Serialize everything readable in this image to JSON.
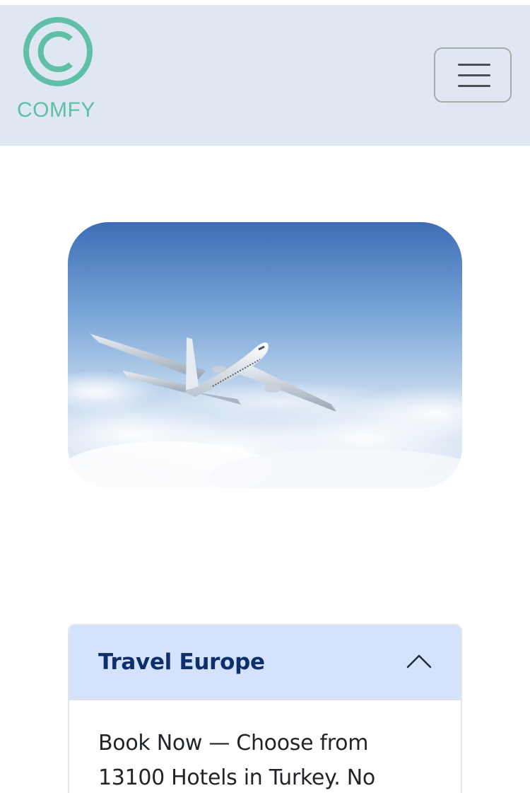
{
  "navbar": {
    "brand_name": "COMFY",
    "logo_icon": "copyright-icon",
    "menu_icon": "hamburger-menu-icon",
    "background_color": "#dfe8f2",
    "brand_color": "#5fc0a6"
  },
  "hero": {
    "image_subject": "airplane-in-sky"
  },
  "accordion": {
    "title": "Travel Europe",
    "expanded_icon": "chevron-up-icon",
    "body_text": "Book Now — Choose from 13100 Hotels in Turkey. No",
    "header_color": "#d5e2fb",
    "title_color": "#0d2f6b"
  }
}
